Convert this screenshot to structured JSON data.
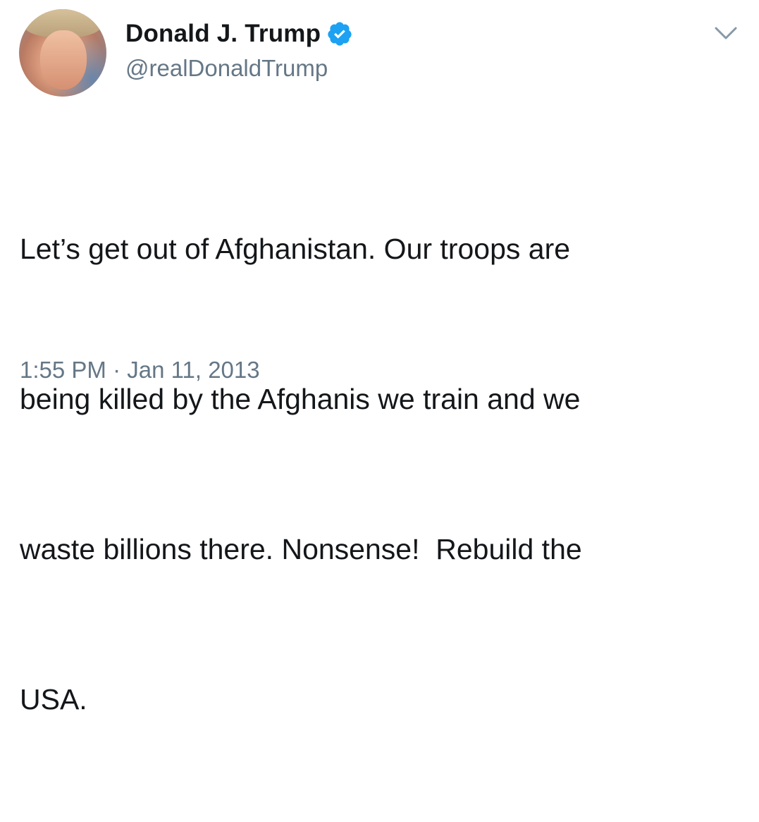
{
  "user": {
    "display_name": "Donald J. Trump",
    "handle": "@realDonaldTrump",
    "verified": true
  },
  "tweet": {
    "lines": [
      "Let’s get out of Afghanistan. Our troops are",
      "being killed by the Afghanis we train and we",
      "waste billions there. Nonsense!  Rebuild the",
      "USA."
    ],
    "time": "1:55 PM · Jan 11, 2013"
  },
  "icons": {
    "verified": "verified-badge-icon",
    "menu": "chevron-down-icon"
  },
  "colors": {
    "text": "#14171a",
    "secondary": "#657786",
    "verified": "#1da1f2"
  }
}
